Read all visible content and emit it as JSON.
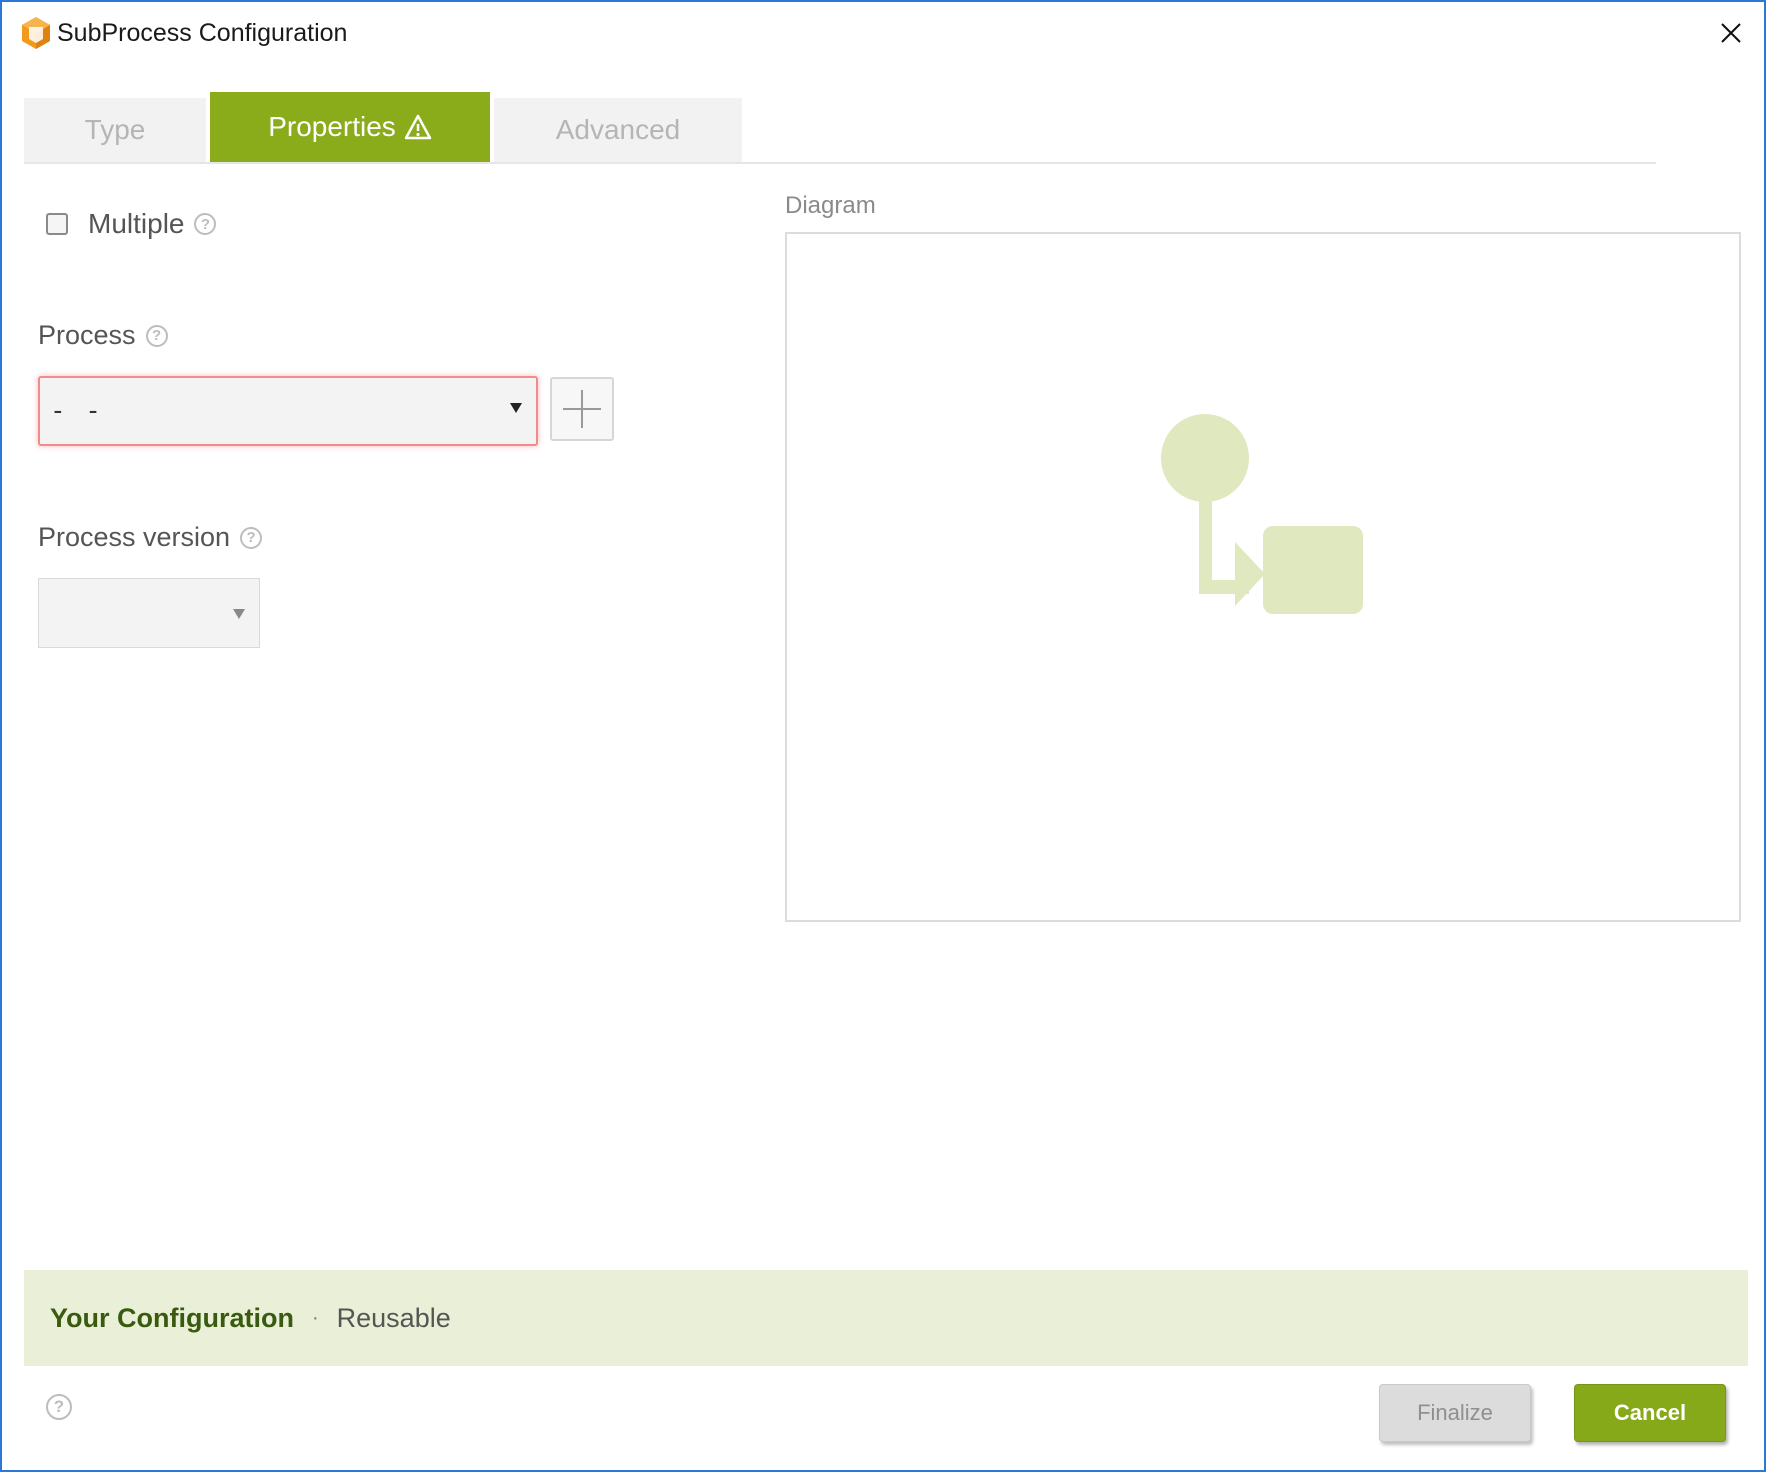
{
  "window": {
    "title": "SubProcess Configuration",
    "app_icon": "orange-cube-icon",
    "close_icon": "close-x-icon"
  },
  "tabs": [
    {
      "label": "Type",
      "active": false
    },
    {
      "label": "Properties",
      "active": true,
      "icon": "warning-triangle-icon"
    },
    {
      "label": "Advanced",
      "active": false
    }
  ],
  "form": {
    "multiple": {
      "label": "Multiple",
      "checked": false
    },
    "process": {
      "label": "Process",
      "value": "- -",
      "add_icon": "plus-icon"
    },
    "process_version": {
      "label": "Process version",
      "value": ""
    }
  },
  "diagram": {
    "label": "Diagram",
    "icon": "subprocess-diagram-icon"
  },
  "configuration": {
    "title": "Your Configuration",
    "separator": "·",
    "value": "Reusable"
  },
  "footer": {
    "help_icon": "help-circle-icon",
    "finalize_label": "Finalize",
    "cancel_label": "Cancel"
  },
  "colors": {
    "accent": "#8aab1a",
    "window_border": "#2b78d6",
    "config_bar": "#e9f0d7",
    "error_border": "#f28b8b",
    "diagram_placeholder": "#dfe8bf"
  }
}
